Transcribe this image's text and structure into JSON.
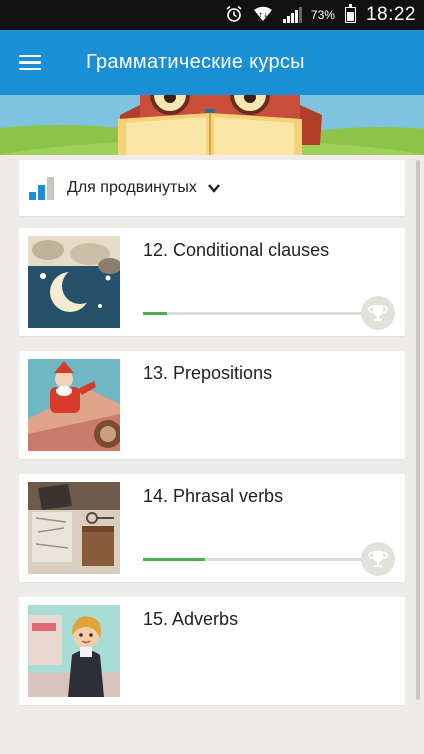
{
  "status_bar": {
    "battery_percent": "73%",
    "time": "18:22",
    "icons": [
      "alarm-icon",
      "wifi-icon",
      "signal-icon",
      "battery-icon"
    ]
  },
  "app_bar": {
    "title": "Грамматические курсы",
    "menu_icon": "hamburger-menu-icon"
  },
  "level_selector": {
    "label": "Для продвинутых",
    "icon": "level-bars-icon",
    "dropdown_icon": "chevron-down-icon"
  },
  "courses": [
    {
      "title": "12. Conditional clauses",
      "progress": 0.11,
      "show_progress": true
    },
    {
      "title": "13. Prepositions",
      "progress": 0,
      "show_progress": false
    },
    {
      "title": "14. Phrasal verbs",
      "progress": 0.28,
      "show_progress": true
    },
    {
      "title": "15. Adverbs",
      "progress": 0,
      "show_progress": false
    }
  ],
  "colors": {
    "app_bar": "#1a8fd6",
    "progress": "#4caf50",
    "background": "#eeece8"
  }
}
